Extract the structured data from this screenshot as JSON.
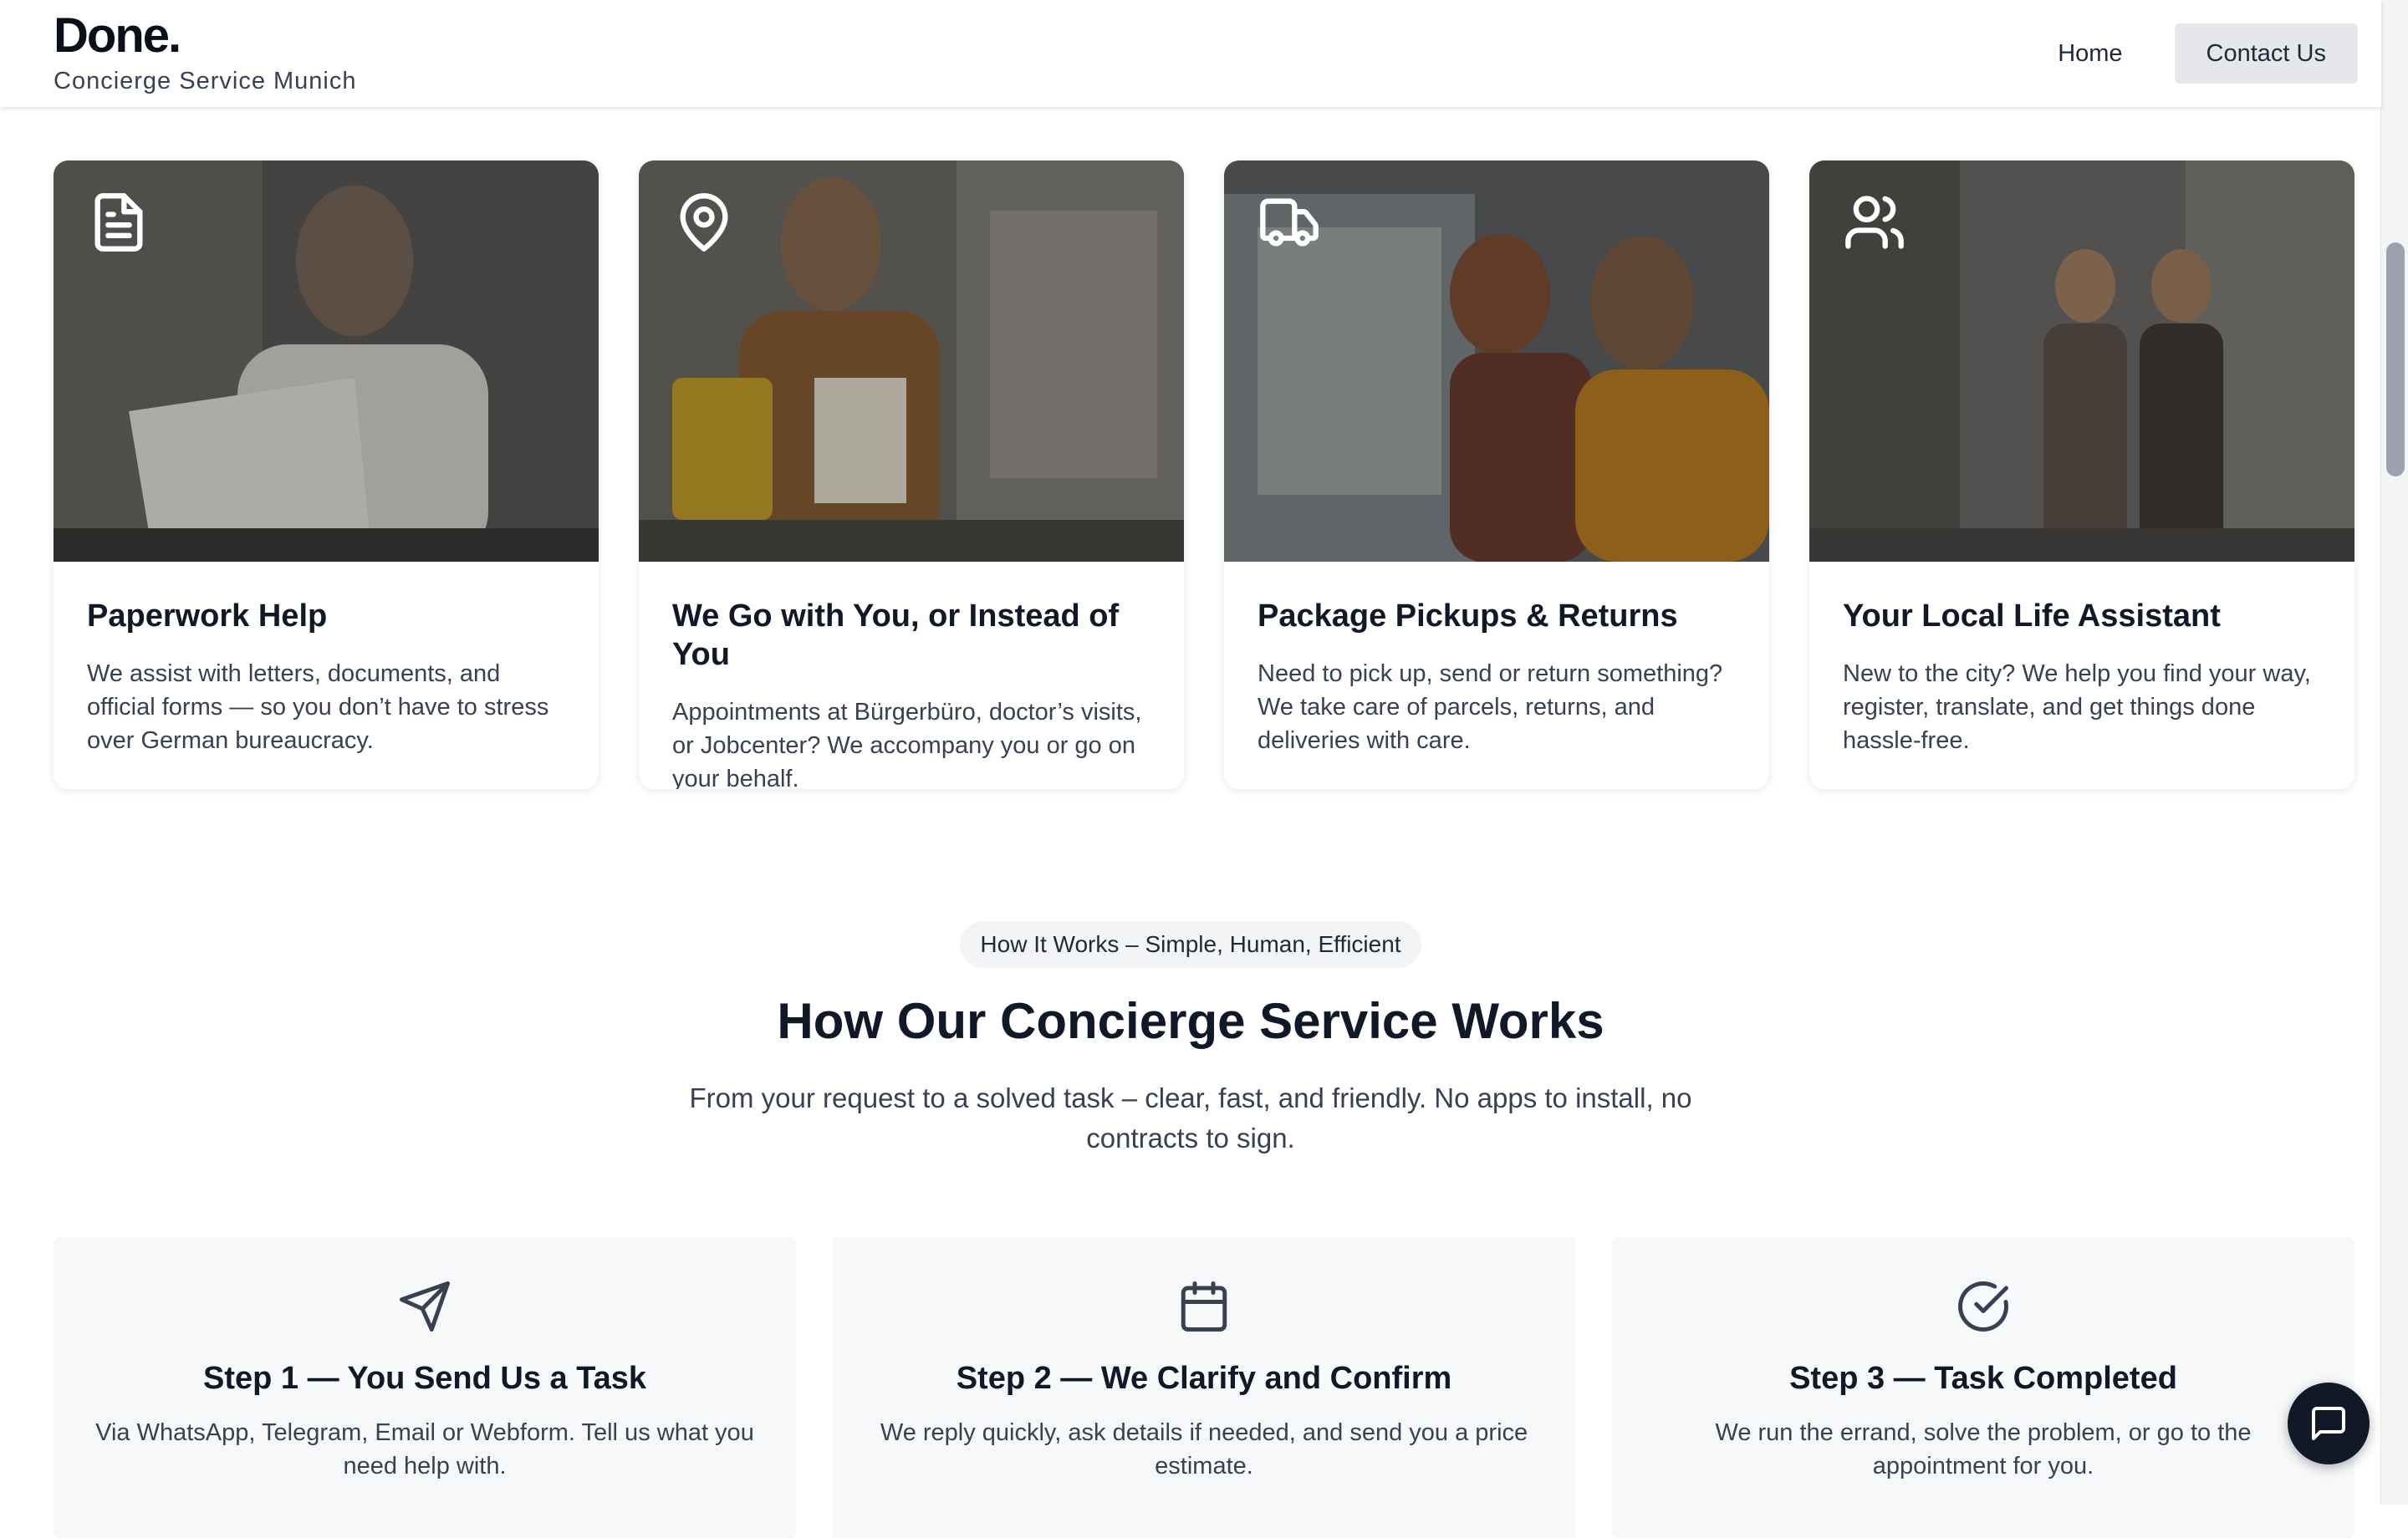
{
  "brand": {
    "name": "Done.",
    "tagline": "Concierge Service Munich"
  },
  "nav": {
    "home": "Home",
    "contact": "Contact Us"
  },
  "services": [
    {
      "icon": "document-icon",
      "title": "Paperwork Help",
      "desc": "We assist with letters, documents, and official forms — so you don’t have to stress over German bureaucracy."
    },
    {
      "icon": "map-pin-icon",
      "title": "We Go with You, or Instead of You",
      "desc": "Appointments at Bürgerbüro, doctor’s visits, or Jobcenter? We accompany you or go on your behalf."
    },
    {
      "icon": "truck-icon",
      "title": "Package Pickups & Returns",
      "desc": "Need to pick up, send or return something? We take care of parcels, returns, and deliveries with care."
    },
    {
      "icon": "users-icon",
      "title": "Your Local Life Assistant",
      "desc": "New to the city? We help you find your way, register, translate, and get things done hassle-free."
    }
  ],
  "how": {
    "badge": "How It Works – Simple, Human, Efficient",
    "title": "How Our Concierge Service Works",
    "subtitle": "From your request to a solved task – clear, fast, and friendly. No apps to install, no contracts to sign."
  },
  "steps": [
    {
      "icon": "send-icon",
      "title": "Step 1 — You Send Us a Task",
      "desc": "Via WhatsApp, Telegram, Email or Webform. Tell us what you need help with."
    },
    {
      "icon": "calendar-icon",
      "title": "Step 2 — We Clarify and Confirm",
      "desc": "We reply quickly, ask details if needed, and send you a price estimate."
    },
    {
      "icon": "check-circle-icon",
      "title": "Step 3 — Task Completed",
      "desc": "We run the errand, solve the problem, or go to the appointment for you."
    }
  ],
  "colors": {
    "accent": "#111827",
    "muted": "#374151",
    "step_bg": "#f7f8fa"
  }
}
